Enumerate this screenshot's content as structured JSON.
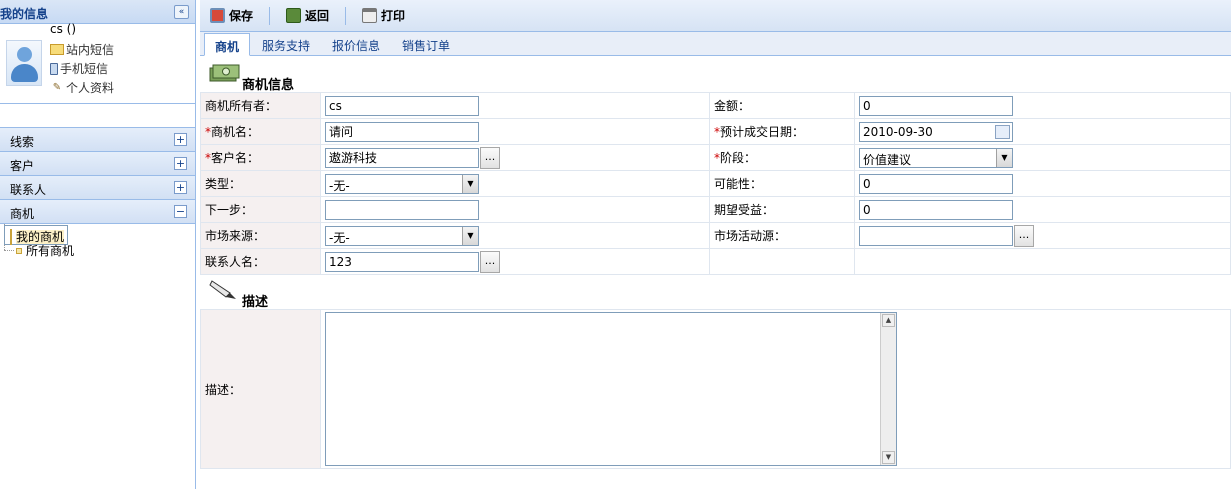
{
  "sidebar": {
    "title": "我的信息",
    "collapse_icon": "«",
    "profile": {
      "username": "cs ()",
      "links": [
        "站内短信",
        "手机短信",
        "个人资料"
      ]
    },
    "accordion": [
      {
        "label": "线索",
        "state": "+"
      },
      {
        "label": "客户",
        "state": "+"
      },
      {
        "label": "联系人",
        "state": "+"
      },
      {
        "label": "商机",
        "state": "−"
      }
    ],
    "tree": [
      "我的商机",
      "所有商机"
    ]
  },
  "toolbar": {
    "save": "保存",
    "back": "返回",
    "print": "打印"
  },
  "tabs": [
    "商机",
    "服务支持",
    "报价信息",
    "销售订单"
  ],
  "section_info": "商机信息",
  "section_desc": "描述",
  "form": {
    "owner_label": "商机所有者：",
    "owner_value": "cs",
    "amount_label": "金额：",
    "amount_value": "0",
    "name_label": "商机名：",
    "name_value": "请问",
    "close_date_label": "预计成交日期：",
    "close_date_value": "2010-09-30",
    "customer_label": "客户名：",
    "customer_value": "遨游科技",
    "stage_label": "阶段：",
    "stage_value": "价值建议",
    "type_label": "类型：",
    "type_value": "-无-",
    "probability_label": "可能性：",
    "probability_value": "0",
    "next_step_label": "下一步：",
    "next_step_value": "",
    "expected_label": "期望受益：",
    "expected_value": "0",
    "source_label": "市场来源：",
    "source_value": "-无-",
    "campaign_label": "市场活动源：",
    "campaign_value": "",
    "contact_label": "联系人名：",
    "contact_value": "123",
    "desc_label": "描述：",
    "required_mark": "*",
    "lookup": "..."
  },
  "colors": {
    "accent": "#15428b",
    "border": "#99bbe8",
    "required": "#cc0000",
    "label_bg": "#f5f0f0"
  }
}
